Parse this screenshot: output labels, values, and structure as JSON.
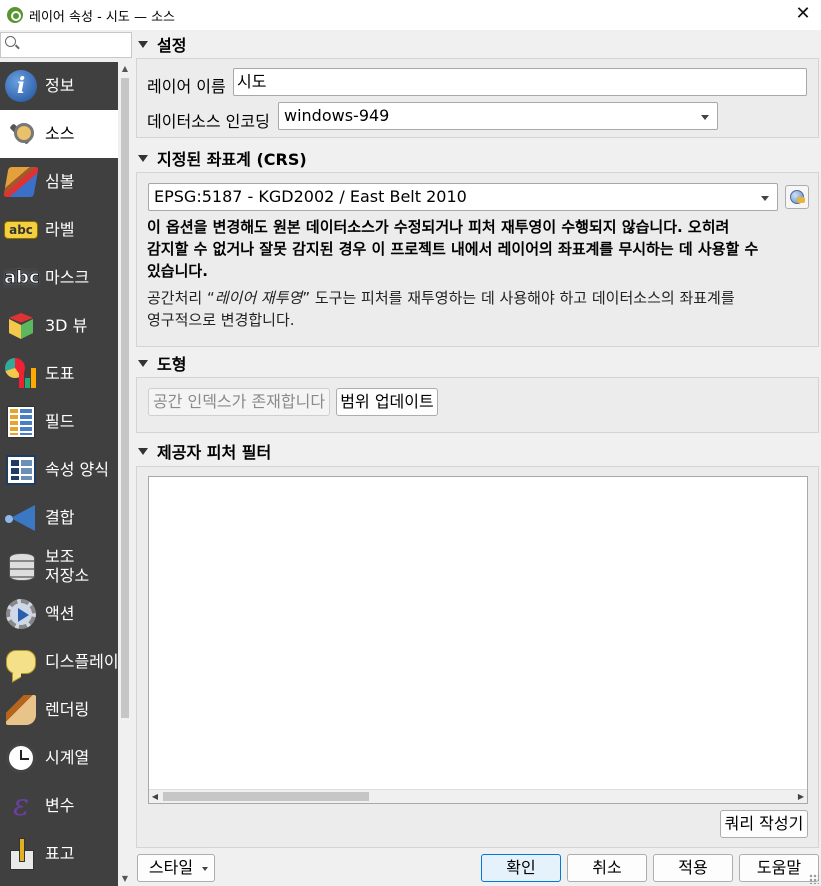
{
  "window": {
    "title": "레이어 속성 - 시도 — 소스",
    "close_label": "✕"
  },
  "search": {
    "placeholder": ""
  },
  "nav": [
    {
      "label": "정보",
      "icon": "info-icon"
    },
    {
      "label": "소스",
      "icon": "source-icon",
      "active": true
    },
    {
      "label": "심볼",
      "icon": "symbology-icon"
    },
    {
      "label": "라벨",
      "icon": "labels-icon"
    },
    {
      "label": "마스크",
      "icon": "mask-icon"
    },
    {
      "label": "3D 뷰",
      "icon": "3d-view-icon"
    },
    {
      "label": "도표",
      "icon": "diagram-icon"
    },
    {
      "label": "필드",
      "icon": "fields-icon"
    },
    {
      "label": "속성 양식",
      "icon": "attributes-form-icon"
    },
    {
      "label": "결합",
      "icon": "joins-icon"
    },
    {
      "label": "보조\n저장소",
      "icon": "auxiliary-storage-icon"
    },
    {
      "label": "액션",
      "icon": "actions-icon"
    },
    {
      "label": "디스플레이",
      "icon": "display-icon"
    },
    {
      "label": "렌더링",
      "icon": "rendering-icon"
    },
    {
      "label": "시계열",
      "icon": "temporal-icon"
    },
    {
      "label": "변수",
      "icon": "variables-icon"
    },
    {
      "label": "표고",
      "icon": "elevation-icon"
    }
  ],
  "settings": {
    "header": "설정",
    "layer_name_label": "레이어 이름",
    "layer_name_value": "시도",
    "encoding_label": "데이터소스 인코딩",
    "encoding_value": "windows-949"
  },
  "crs": {
    "header": "지정된 좌표계 (CRS)",
    "value": "EPSG:5187 - KGD2002 / East Belt 2010",
    "warning_line1": "이 옵션을 변경해도 원본 데이터소스가 수정되거나 피처 재투영이 수행되지 않습니다. 오히려",
    "warning_line2": "감지할 수 없거나 잘못 감지된 경우 이 프로젝트 내에서 레이어의 좌표계를 무시하는 데 사용할 수",
    "warning_line3": "있습니다.",
    "note_prefix": "공간처리 “",
    "note_tool": "레이어 재투영",
    "note_suffix": "” 도구는 피처를 재투영하는 데 사용해야 하고 데이터소스의 좌표계를",
    "note_line2": "영구적으로 변경합니다."
  },
  "geometry": {
    "header": "도형",
    "spatial_index_button": "공간 인덱스가 존재합니다",
    "update_extents_button": "범위 업데이트"
  },
  "filter": {
    "header": "제공자 피처 필터",
    "query_builder_button": "쿼리 작성기"
  },
  "footer": {
    "style_button": "스타일",
    "ok_button": "확인",
    "cancel_button": "취소",
    "apply_button": "적용",
    "help_button": "도움말"
  }
}
